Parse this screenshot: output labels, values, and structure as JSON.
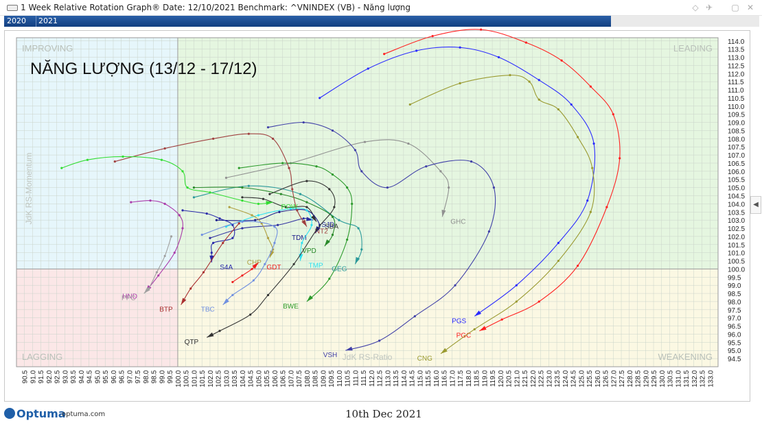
{
  "window": {
    "title": "1 Week Relative Rotation Graph®   Date: 12/10/2021   Benchmark:  ^VNINDEX (VB) - Năng lượng",
    "icons": [
      "chart-icon",
      "pin-icon",
      "maximize-icon",
      "close-icon"
    ]
  },
  "timebar": {
    "years": [
      "2020",
      "2021"
    ]
  },
  "chart_data": {
    "type": "scatter",
    "title": "NĂNG LƯỢNG (13/12 - 17/12)",
    "xlabel": "JdK RS-Ratio",
    "ylabel": "JdK RS-Momentum",
    "xlim": [
      90.0,
      133.5
    ],
    "ylim": [
      94.0,
      114.2
    ],
    "x_ticks": [
      90.5,
      91.0,
      91.5,
      92.0,
      92.5,
      93.0,
      93.5,
      94.0,
      94.5,
      95.0,
      95.5,
      96.0,
      96.5,
      97.0,
      97.5,
      98.0,
      98.5,
      99.0,
      99.5,
      100.0,
      100.5,
      101.0,
      101.5,
      102.0,
      102.5,
      103.0,
      103.5,
      104.0,
      104.5,
      105.0,
      105.5,
      106.0,
      106.5,
      107.0,
      107.5,
      108.0,
      108.5,
      109.0,
      109.5,
      110.0,
      110.5,
      111.0,
      111.5,
      112.0,
      112.5,
      113.0,
      113.5,
      114.0,
      114.5,
      115.0,
      115.5,
      116.0,
      116.5,
      117.0,
      117.5,
      118.0,
      118.5,
      119.0,
      119.5,
      120.0,
      120.5,
      121.0,
      121.5,
      122.0,
      122.5,
      123.0,
      123.5,
      124.0,
      124.5,
      125.0,
      125.5,
      126.0,
      126.5,
      127.0,
      127.5,
      128.0,
      128.5,
      129.0,
      129.5,
      130.0,
      130.5,
      131.0,
      131.5,
      132.0,
      132.5,
      133.0
    ],
    "y_ticks": [
      94.5,
      95.0,
      95.5,
      96.0,
      96.5,
      97.0,
      97.5,
      98.0,
      98.5,
      99.0,
      99.5,
      100.0,
      100.5,
      101.0,
      101.5,
      102.0,
      102.5,
      103.0,
      103.5,
      104.0,
      104.5,
      105.0,
      105.5,
      106.0,
      106.5,
      107.0,
      107.5,
      108.0,
      108.5,
      109.0,
      109.5,
      110.0,
      110.5,
      111.0,
      111.5,
      112.0,
      112.5,
      113.0,
      113.5,
      114.0
    ],
    "center": [
      100.0,
      100.0
    ],
    "quadrants": [
      {
        "name": "IMPROVING",
        "color": "#e6f6fb"
      },
      {
        "name": "LEADING",
        "color": "#e5f6e0"
      },
      {
        "name": "LAGGING",
        "color": "#fbe7e7"
      },
      {
        "name": "WEAKENING",
        "color": "#fbf8e3"
      }
    ],
    "grid": true,
    "series": [
      {
        "name": "PGC",
        "color": "#ff2020",
        "points": [
          [
            112.8,
            113.2
          ],
          [
            115.8,
            114.3
          ],
          [
            118.8,
            114.7
          ],
          [
            121.6,
            113.9
          ],
          [
            123.8,
            112.8
          ],
          [
            125.6,
            111.2
          ],
          [
            127.0,
            109.5
          ],
          [
            127.4,
            106.8
          ],
          [
            126.6,
            103.8
          ],
          [
            124.8,
            100.2
          ],
          [
            122.4,
            98.0
          ],
          [
            120.1,
            96.9
          ],
          [
            118.7,
            96.2
          ]
        ]
      },
      {
        "name": "PGS",
        "color": "#2a2aff",
        "points": [
          [
            108.8,
            110.5
          ],
          [
            111.8,
            112.3
          ],
          [
            114.8,
            113.4
          ],
          [
            117.5,
            113.6
          ],
          [
            119.9,
            113.0
          ],
          [
            122.4,
            111.6
          ],
          [
            124.4,
            110.1
          ],
          [
            125.8,
            107.7
          ],
          [
            125.4,
            104.2
          ],
          [
            123.6,
            101.6
          ],
          [
            121.0,
            99.0
          ],
          [
            118.4,
            97.1
          ]
        ]
      },
      {
        "name": "CNG",
        "color": "#9a9a30",
        "points": [
          [
            114.4,
            110.1
          ],
          [
            117.5,
            111.4
          ],
          [
            120.6,
            111.9
          ],
          [
            121.8,
            111.5
          ],
          [
            122.4,
            110.4
          ],
          [
            123.6,
            109.8
          ],
          [
            124.8,
            108.1
          ],
          [
            125.7,
            106.2
          ],
          [
            125.6,
            103.5
          ],
          [
            123.6,
            100.5
          ],
          [
            121.0,
            98.0
          ],
          [
            118.4,
            96.3
          ],
          [
            116.3,
            94.8
          ]
        ]
      },
      {
        "name": "GHC",
        "color": "#909090",
        "points": [
          [
            103.0,
            105.6
          ],
          [
            107.0,
            106.5
          ],
          [
            111.6,
            107.8
          ],
          [
            114.3,
            107.7
          ],
          [
            116.3,
            106.0
          ],
          [
            116.8,
            105.0
          ],
          [
            116.4,
            103.2
          ]
        ]
      },
      {
        "name": "VSH",
        "color": "#4040a8",
        "points": [
          [
            105.6,
            108.7
          ],
          [
            107.8,
            109.0
          ],
          [
            109.6,
            108.5
          ],
          [
            111.0,
            107.3
          ],
          [
            111.4,
            106.0
          ],
          [
            113.0,
            105.0
          ],
          [
            115.4,
            106.3
          ],
          [
            118.2,
            106.6
          ],
          [
            119.6,
            105.0
          ],
          [
            119.3,
            102.3
          ],
          [
            117.2,
            99.0
          ],
          [
            114.7,
            97.1
          ],
          [
            112.5,
            95.6
          ],
          [
            110.4,
            95.0
          ]
        ]
      },
      {
        "name": "BWE",
        "color": "#2b9a2b",
        "points": [
          [
            103.8,
            106.2
          ],
          [
            106.5,
            106.5
          ],
          [
            108.6,
            106.3
          ],
          [
            109.6,
            105.8
          ],
          [
            110.5,
            105.0
          ],
          [
            110.8,
            104.0
          ],
          [
            110.5,
            101.8
          ],
          [
            109.4,
            99.4
          ],
          [
            108.0,
            98.0
          ]
        ]
      },
      {
        "name": "GEG",
        "color": "#2a9a9a",
        "points": [
          [
            101.0,
            104.4
          ],
          [
            104.4,
            105.1
          ],
          [
            107.6,
            104.6
          ],
          [
            110.0,
            103.0
          ],
          [
            111.2,
            102.5
          ],
          [
            111.4,
            101.2
          ],
          [
            111.0,
            100.3
          ]
        ]
      },
      {
        "name": "VPD",
        "color": "#2a8a2a",
        "points": [
          [
            101.0,
            105.0
          ],
          [
            104.0,
            105.0
          ],
          [
            106.4,
            104.6
          ],
          [
            108.0,
            104.1
          ],
          [
            109.6,
            103.2
          ],
          [
            109.6,
            102.1
          ],
          [
            109.1,
            101.4
          ]
        ]
      },
      {
        "name": "SBA",
        "color": "#333333",
        "points": [
          [
            104.0,
            104.4
          ],
          [
            105.3,
            104.3
          ],
          [
            106.7,
            103.8
          ],
          [
            108.0,
            103.8
          ],
          [
            108.6,
            102.9
          ]
        ]
      },
      {
        "name": "TDM",
        "color": "#1a1a8a",
        "points": [
          [
            102.4,
            103.0
          ],
          [
            104.8,
            103.0
          ],
          [
            106.3,
            103.5
          ],
          [
            108.0,
            103.6
          ],
          [
            108.8,
            102.7
          ],
          [
            108.5,
            102.2
          ]
        ]
      },
      {
        "name": "SJD",
        "color": "#3030a0",
        "points": [
          [
            102.0,
            101.9
          ],
          [
            104.0,
            102.5
          ],
          [
            106.2,
            102.7
          ],
          [
            107.8,
            103.1
          ],
          [
            108.4,
            103.0
          ]
        ]
      },
      {
        "name": "NT2",
        "color": "#a04040",
        "points": [
          [
            96.1,
            106.6
          ],
          [
            99.2,
            107.4
          ],
          [
            102.2,
            108.0
          ],
          [
            104.4,
            108.3
          ],
          [
            105.9,
            108.0
          ],
          [
            106.9,
            106.2
          ],
          [
            107.1,
            104.9
          ],
          [
            107.4,
            103.6
          ],
          [
            108.0,
            102.6
          ]
        ]
      },
      {
        "name": "POW",
        "color": "#33dd33",
        "points": [
          [
            92.8,
            106.2
          ],
          [
            94.4,
            106.7
          ],
          [
            96.6,
            106.9
          ],
          [
            99.0,
            106.7
          ],
          [
            100.3,
            106.0
          ],
          [
            100.6,
            105.0
          ],
          [
            102.0,
            104.7
          ],
          [
            104.0,
            104.2
          ],
          [
            105.0,
            104.0
          ],
          [
            105.9,
            104.1
          ]
        ]
      },
      {
        "name": "TMP",
        "color": "#30e0f0",
        "points": [
          [
            103.0,
            102.6
          ],
          [
            105.0,
            103.3
          ],
          [
            107.0,
            103.7
          ],
          [
            108.0,
            103.6
          ],
          [
            108.3,
            102.7
          ],
          [
            107.7,
            101.6
          ],
          [
            107.6,
            100.5
          ]
        ]
      },
      {
        "name": "CHP",
        "color": "#b0a040",
        "points": [
          [
            103.2,
            103.8
          ],
          [
            104.6,
            103.3
          ],
          [
            105.2,
            102.8
          ],
          [
            105.6,
            101.9
          ],
          [
            105.9,
            101.2
          ],
          [
            105.7,
            100.7
          ]
        ]
      },
      {
        "name": "GDT",
        "color": "#ee2020",
        "points": [
          [
            103.4,
            99.2
          ],
          [
            104.0,
            99.6
          ],
          [
            104.6,
            100.0
          ],
          [
            105.0,
            100.4
          ]
        ]
      },
      {
        "name": "S4A",
        "color": "#2a2aaa",
        "points": [
          [
            100.3,
            103.6
          ],
          [
            101.8,
            103.4
          ],
          [
            102.6,
            103.1
          ],
          [
            103.4,
            102.7
          ],
          [
            103.4,
            101.9
          ],
          [
            102.2,
            101.6
          ],
          [
            102.1,
            101.0
          ],
          [
            102.1,
            100.4
          ]
        ]
      },
      {
        "name": "TBC",
        "color": "#7090e0",
        "points": [
          [
            101.5,
            102.1
          ],
          [
            104.0,
            102.9
          ],
          [
            106.0,
            102.6
          ],
          [
            106.0,
            101.6
          ],
          [
            105.4,
            100.3
          ],
          [
            104.7,
            99.3
          ],
          [
            103.4,
            98.4
          ],
          [
            102.8,
            97.8
          ]
        ]
      },
      {
        "name": "QTP",
        "color": "#333333",
        "points": [
          [
            105.7,
            104.6
          ],
          [
            108.0,
            105.4
          ],
          [
            109.4,
            104.9
          ],
          [
            109.7,
            103.8
          ],
          [
            108.6,
            102.4
          ],
          [
            107.2,
            100.3
          ],
          [
            105.6,
            98.4
          ],
          [
            104.5,
            97.2
          ],
          [
            102.6,
            96.2
          ],
          [
            101.8,
            95.8
          ]
        ]
      },
      {
        "name": "BTP",
        "color": "#aa3030",
        "points": [
          [
            103.8,
            102.8
          ],
          [
            102.8,
            101.6
          ],
          [
            101.6,
            99.8
          ],
          [
            100.8,
            98.8
          ],
          [
            100.2,
            97.8
          ]
        ]
      },
      {
        "name": "HND",
        "color": "#aa3aaa",
        "points": [
          [
            97.1,
            104.1
          ],
          [
            98.3,
            104.2
          ],
          [
            99.2,
            104.0
          ],
          [
            100.1,
            103.3
          ],
          [
            100.3,
            102.5
          ],
          [
            99.8,
            101.0
          ],
          [
            98.8,
            99.6
          ],
          [
            98.0,
            98.6
          ]
        ]
      },
      {
        "name": "PPC",
        "color": "#a0a0a0",
        "points": [
          [
            99.6,
            102.0
          ],
          [
            99.2,
            100.8
          ],
          [
            98.7,
            99.8
          ],
          [
            98.2,
            98.8
          ],
          [
            97.9,
            98.5
          ]
        ]
      }
    ]
  },
  "footer": {
    "brand": "Optuma",
    "url": "optuma.com",
    "date": "10th Dec 2021"
  }
}
